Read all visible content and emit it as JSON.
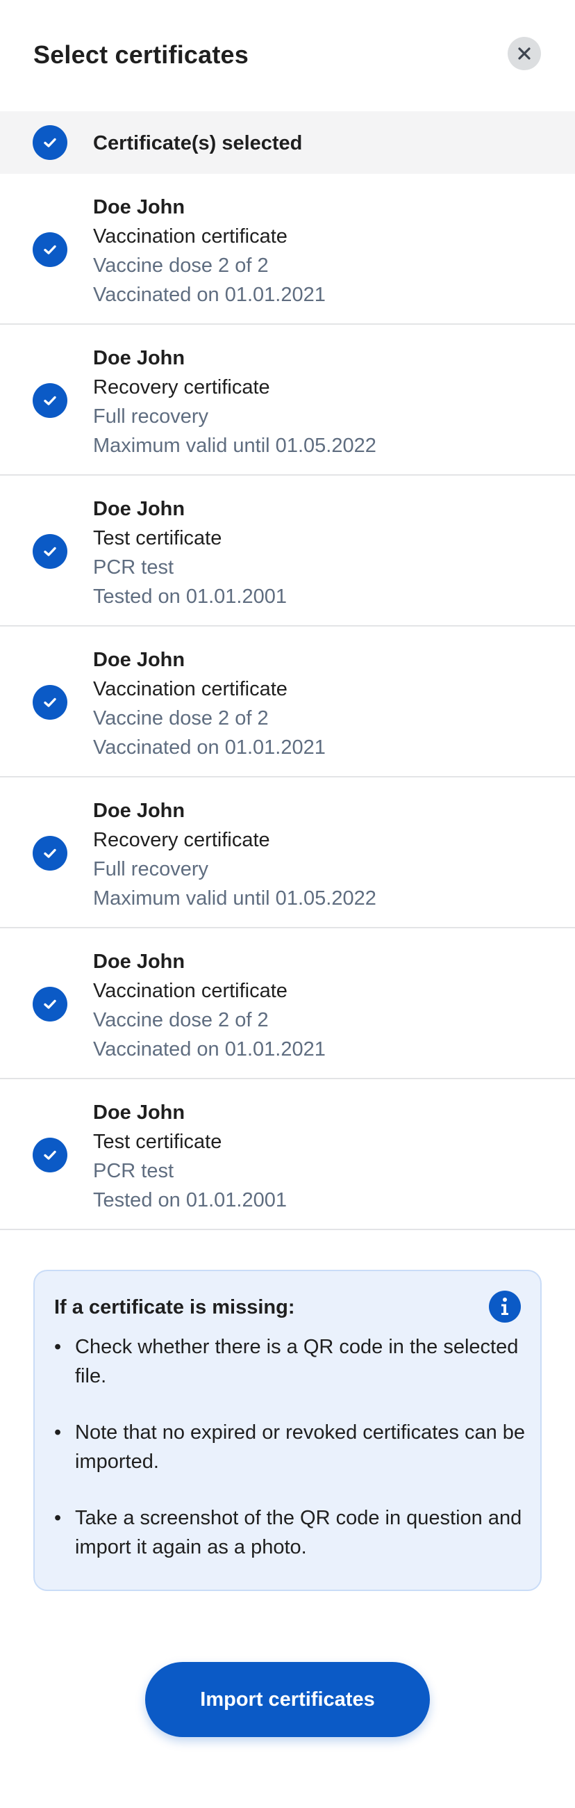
{
  "header": {
    "title": "Select certificates",
    "close_icon": "close-icon"
  },
  "select_all": {
    "label": "Certificate(s) selected",
    "checked": true
  },
  "certificates": [
    {
      "name": "Doe John",
      "type": "Vaccination certificate",
      "detail1": "Vaccine dose 2 of 2",
      "detail2": "Vaccinated on 01.01.2021",
      "checked": true
    },
    {
      "name": "Doe John",
      "type": "Recovery certificate",
      "detail1": "Full recovery",
      "detail2": "Maximum valid until 01.05.2022",
      "checked": true
    },
    {
      "name": "Doe John",
      "type": "Test certificate",
      "detail1": "PCR test",
      "detail2": "Tested on 01.01.2001",
      "checked": true
    },
    {
      "name": "Doe John",
      "type": "Vaccination certificate",
      "detail1": "Vaccine dose 2 of 2",
      "detail2": "Vaccinated on 01.01.2021",
      "checked": true
    },
    {
      "name": "Doe John",
      "type": "Recovery certificate",
      "detail1": "Full recovery",
      "detail2": "Maximum valid until 01.05.2022",
      "checked": true
    },
    {
      "name": "Doe John",
      "type": "Vaccination certificate",
      "detail1": "Vaccine dose 2 of 2",
      "detail2": "Vaccinated on 01.01.2021",
      "checked": true
    },
    {
      "name": "Doe John",
      "type": "Test certificate",
      "detail1": "PCR test",
      "detail2": "Tested on 01.01.2001",
      "checked": true
    }
  ],
  "info": {
    "title": "If a certificate is missing:",
    "icon": "info-icon",
    "items": [
      "Check whether there is a QR code in the selected file.",
      "Note that no expired or revoked certificates can be imported.",
      "Take a screenshot of the QR code in question and import it again as a photo."
    ]
  },
  "import_button": {
    "label": "Import certificates"
  },
  "colors": {
    "accent": "#0b5ac6",
    "secondary_text": "#5f6d80",
    "info_background": "#eaf1fc",
    "selected_row_background": "#f4f4f5"
  }
}
